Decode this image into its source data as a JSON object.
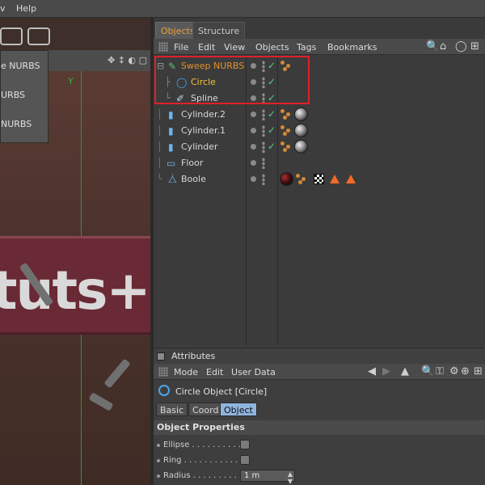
{
  "menubar": {
    "items": [
      "v",
      "Help"
    ]
  },
  "viewport": {
    "dropdown_items": [
      "e NURBS",
      "URBS",
      "NURBS"
    ],
    "axis_label": "Y",
    "scene_text": "tuts+",
    "nav_icons": "✥ ↕ ◐ ▢"
  },
  "object_manager": {
    "tabs": [
      "Objects",
      "Structure"
    ],
    "menu": [
      "File",
      "Edit",
      "View",
      "Objects",
      "Tags",
      "Bookmarks"
    ],
    "objects": [
      {
        "name": "Sweep NURBS",
        "color": "#e0922e",
        "icon": "sweep-nurbs-icon"
      },
      {
        "name": "Circle",
        "color": "#f0c040",
        "icon": "circle-spline-icon"
      },
      {
        "name": "Spline",
        "color": "#d8d8d8",
        "icon": "spline-icon"
      },
      {
        "name": "Cylinder.2",
        "color": "#d8d8d8",
        "icon": "cylinder-icon"
      },
      {
        "name": "Cylinder.1",
        "color": "#d8d8d8",
        "icon": "cylinder-icon"
      },
      {
        "name": "Cylinder",
        "color": "#d8d8d8",
        "icon": "cylinder-icon"
      },
      {
        "name": "Floor",
        "color": "#d8d8d8",
        "icon": "floor-icon"
      },
      {
        "name": "Boole",
        "color": "#d8d8d8",
        "icon": "boole-icon"
      }
    ]
  },
  "attributes": {
    "header": "Attributes",
    "menu": [
      "Mode",
      "Edit",
      "User Data"
    ],
    "object_title": "Circle Object [Circle]",
    "tabs": [
      "Basic",
      "Coord",
      "Object"
    ],
    "active_tab": "Object",
    "section": "Object Properties",
    "props": {
      "ellipse_label": "Ellipse . . . . . . . . . .",
      "ring_label": "Ring . . . . . . . . . . . .",
      "radius_label": "Radius . . . . . . . . . .",
      "radius_value": "1 m"
    }
  }
}
